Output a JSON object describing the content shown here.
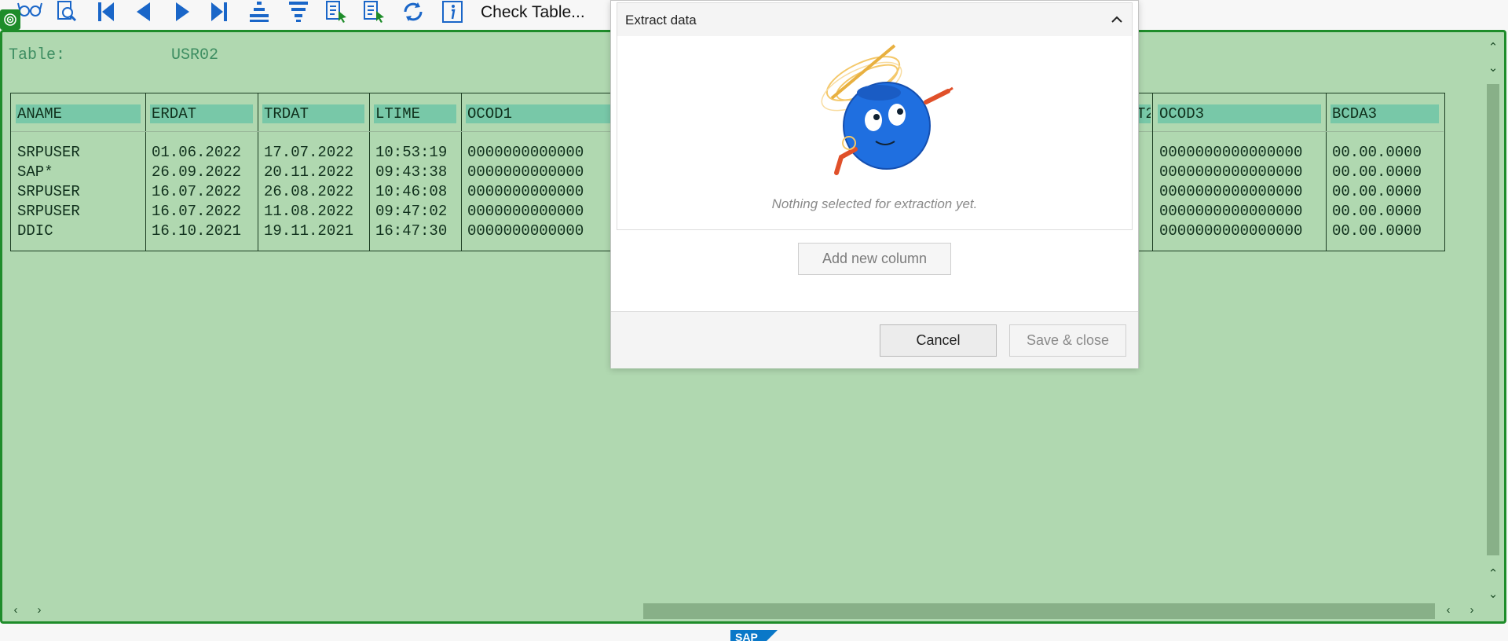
{
  "toolbar": {
    "buttons": [
      {
        "icon": "glasses-icon"
      },
      {
        "icon": "find-icon"
      },
      {
        "icon": "first-page-icon"
      },
      {
        "icon": "previous-page-icon"
      },
      {
        "icon": "next-page-icon"
      },
      {
        "icon": "last-page-icon"
      },
      {
        "icon": "sort-ascending-icon"
      },
      {
        "icon": "sort-descending-icon"
      },
      {
        "icon": "select-icon-1"
      },
      {
        "icon": "select-icon-2"
      },
      {
        "icon": "refresh-icon"
      },
      {
        "icon": "info-icon"
      }
    ],
    "check_table_label": "Check Table..."
  },
  "table_header": {
    "caption": "Table:",
    "name": "USR02"
  },
  "table": {
    "columns": [
      "ANAME",
      "ERDAT",
      "TRDAT",
      "LTIME",
      "OCOD1",
      "OCOD3",
      "BCDA3"
    ],
    "partial_column_label": "T2",
    "rows": [
      [
        "SRPUSER",
        "01.06.2022",
        "17.07.2022",
        "10:53:19",
        "0000000000000",
        "0000000000000000",
        "00.00.0000"
      ],
      [
        "SAP*",
        "26.09.2022",
        "20.11.2022",
        "09:43:38",
        "0000000000000",
        "0000000000000000",
        "00.00.0000"
      ],
      [
        "SRPUSER",
        "16.07.2022",
        "26.08.2022",
        "10:46:08",
        "0000000000000",
        "0000000000000000",
        "00.00.0000"
      ],
      [
        "SRPUSER",
        "16.07.2022",
        "11.08.2022",
        "09:47:02",
        "0000000000000",
        "0000000000000000",
        "00.00.0000"
      ],
      [
        "DDIC",
        "16.10.2021",
        "19.11.2021",
        "16:47:30",
        "0000000000000",
        "0000000000000000",
        "00.00.0000"
      ]
    ]
  },
  "dialog": {
    "title": "Extract data",
    "empty_message": "Nothing selected for extraction yet.",
    "add_column_label": "Add new column",
    "cancel_label": "Cancel",
    "save_label": "Save & close"
  },
  "colors": {
    "accent": "#1e8c2a",
    "table_background": "#b0d8b0",
    "header_highlight": "#78c8a8",
    "toolbar_icon": "#1a66c8"
  }
}
